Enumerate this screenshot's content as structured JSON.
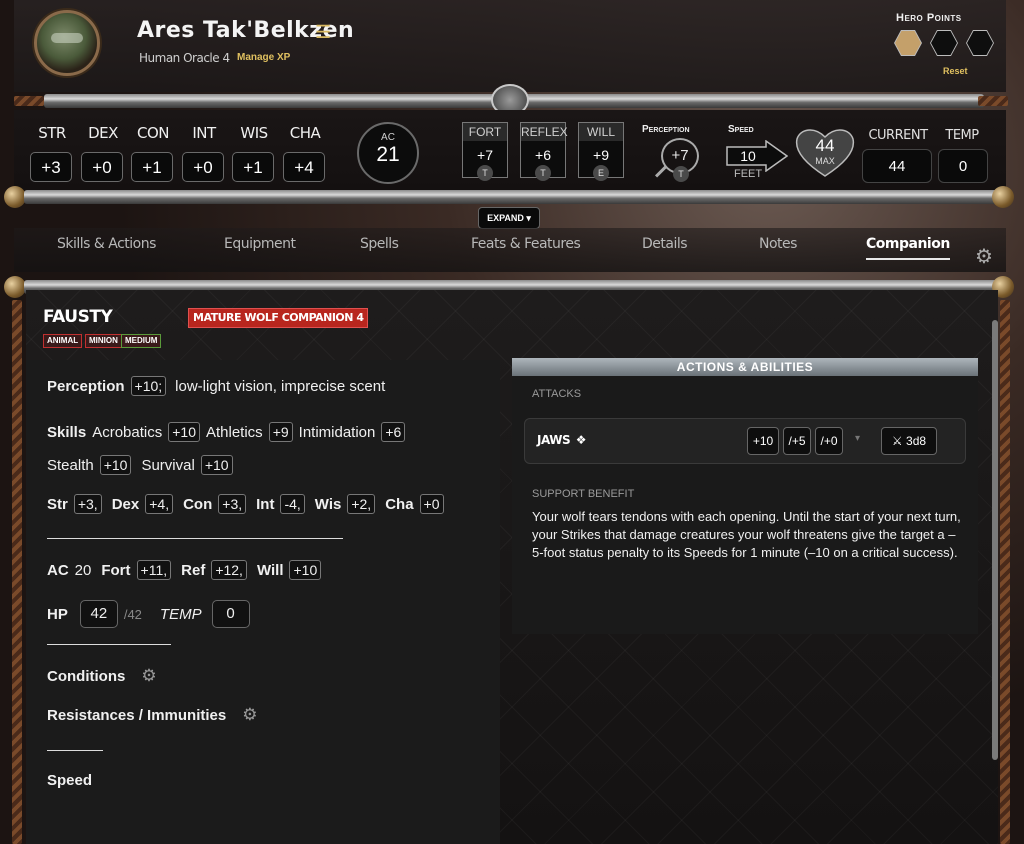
{
  "header": {
    "name": "Ares Tak'Belkzen",
    "class_level": "Human Oracle 4",
    "manage_xp": "Manage XP",
    "hero_points_title": "Hero Points",
    "hero_points_filled": 1,
    "hero_points_total": 3,
    "reset": "Reset"
  },
  "abilities": [
    {
      "label": "STR",
      "value": "+3"
    },
    {
      "label": "DEX",
      "value": "+0"
    },
    {
      "label": "CON",
      "value": "+1"
    },
    {
      "label": "INT",
      "value": "+0"
    },
    {
      "label": "WIS",
      "value": "+1"
    },
    {
      "label": "CHA",
      "value": "+4"
    }
  ],
  "ac": {
    "label": "AC",
    "value": "21"
  },
  "saves": [
    {
      "label": "FORT",
      "value": "+7",
      "prof": "T"
    },
    {
      "label": "REFLEX",
      "value": "+6",
      "prof": "T"
    },
    {
      "label": "WILL",
      "value": "+9",
      "prof": "E"
    }
  ],
  "perception": {
    "label": "Perception",
    "value": "+7",
    "prof": "T"
  },
  "speed": {
    "label": "Speed",
    "value": "10",
    "unit": "FEET"
  },
  "hp": {
    "max": "44",
    "max_label": "MAX",
    "current_label": "CURRENT",
    "current": "44",
    "temp_label": "TEMP",
    "temp": "0"
  },
  "expand": "EXPAND ▾",
  "tabs": [
    "Skills & Actions",
    "Equipment",
    "Spells",
    "Feats & Features",
    "Details",
    "Notes",
    "Companion"
  ],
  "active_tab": "Companion",
  "companion": {
    "name": "Fausty",
    "traits": [
      "Animal",
      "Minion",
      "Medium"
    ],
    "level_badge": "Mature Wolf Companion 4",
    "perception_label": "Perception",
    "perception_value": "+10;",
    "senses": "low-light vision, imprecise scent",
    "skills_label": "Skills",
    "skills": [
      {
        "name": "Acrobatics",
        "value": "+10"
      },
      {
        "name": "Athletics",
        "value": "+9"
      },
      {
        "name": "Intimidation",
        "value": "+6"
      },
      {
        "name": "Stealth",
        "value": "+10"
      },
      {
        "name": "Survival",
        "value": "+10"
      }
    ],
    "attributes": [
      {
        "name": "Str",
        "value": "+3,"
      },
      {
        "name": "Dex",
        "value": "+4,"
      },
      {
        "name": "Con",
        "value": "+3,"
      },
      {
        "name": "Int",
        "value": "-4,"
      },
      {
        "name": "Wis",
        "value": "+2,"
      },
      {
        "name": "Cha",
        "value": "+0"
      }
    ],
    "ac_label": "AC",
    "ac_value": "20",
    "saves": [
      {
        "name": "Fort",
        "value": "+11,"
      },
      {
        "name": "Ref",
        "value": "+12,"
      },
      {
        "name": "Will",
        "value": "+10"
      }
    ],
    "hp_label": "HP",
    "hp_current": "42",
    "hp_max": "/42",
    "temp_label": "TEMP",
    "temp_value": "0",
    "conditions_label": "Conditions",
    "resist_label": "Resistances / Immunities",
    "speed_label": "Speed"
  },
  "actions": {
    "header": "Actions & Abilities",
    "attacks_label": "ATTACKS",
    "attack": {
      "name": "JAWS",
      "map": [
        "+10",
        "/+5",
        "/+0"
      ],
      "damage": "3d8"
    },
    "support_label": "SUPPORT BENEFIT",
    "support_text": "Your wolf tears tendons with each opening. Until the start of your next turn, your Strikes that damage creatures your wolf threatens give the target a –5-foot status penalty to its Speeds for 1 minute (–10 on a critical success)."
  },
  "colors": {
    "accent": "#b8261e",
    "gold": "#e0c060",
    "hero_filled": "#c4a06a"
  }
}
